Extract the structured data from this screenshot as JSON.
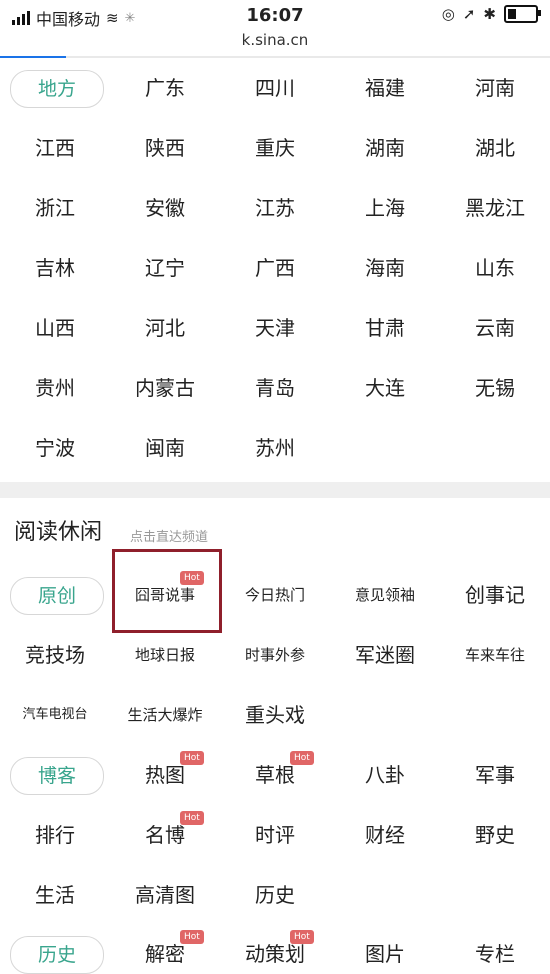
{
  "status_bar": {
    "carrier": "中国移动",
    "time": "16:07",
    "right_icons": [
      "lock-rotation-icon",
      "location-icon",
      "bluetooth-icon",
      "battery-icon"
    ]
  },
  "browser": {
    "url": "k.sina.cn",
    "progress": 0.12
  },
  "regions": {
    "label": "地方",
    "rows": [
      [
        "广东",
        "四川",
        "福建",
        "河南"
      ],
      [
        "江西",
        "陕西",
        "重庆",
        "湖南",
        "湖北"
      ],
      [
        "浙江",
        "安徽",
        "江苏",
        "上海",
        "黑龙江"
      ],
      [
        "吉林",
        "辽宁",
        "广西",
        "海南",
        "山东"
      ],
      [
        "山西",
        "河北",
        "天津",
        "甘肃",
        "云南"
      ],
      [
        "贵州",
        "内蒙古",
        "青岛",
        "大连",
        "无锡"
      ],
      [
        "宁波",
        "闽南",
        "苏州"
      ]
    ]
  },
  "leisure": {
    "title": "阅读休闲",
    "hint": "点击直达频道",
    "hot_label": "Hot",
    "original_label": "原创",
    "original_rows": [
      [
        "囧哥说事",
        "今日热门",
        "意见领袖",
        "创事记"
      ],
      [
        "竞技场",
        "地球日报",
        "时事外参",
        "军迷圈",
        "车来车往"
      ],
      [
        "汽车电视台",
        "生活大爆炸",
        "重头戏"
      ]
    ],
    "blog_label": "博客",
    "blog_rows": [
      [
        "热图",
        "草根",
        "八卦",
        "军事"
      ],
      [
        "排行",
        "名博",
        "时评",
        "财经",
        "野史"
      ],
      [
        "生活",
        "高清图",
        "历史"
      ]
    ],
    "history_label": "历史",
    "history_row": [
      "解密",
      "动策划",
      "图片",
      "专栏"
    ]
  }
}
